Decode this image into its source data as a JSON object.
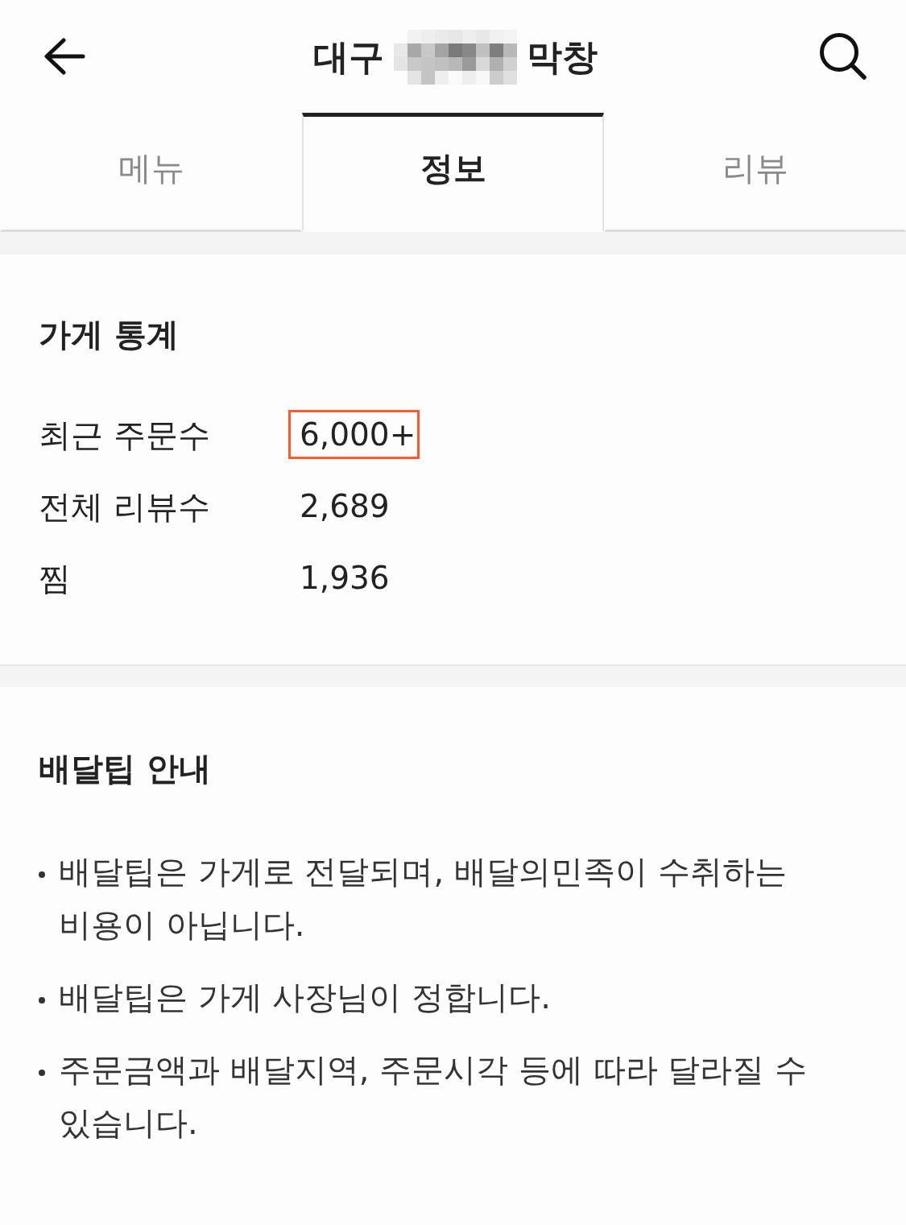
{
  "header": {
    "title": {
      "start": "대구",
      "end": "막창",
      "redacted": true
    }
  },
  "tabs": [
    {
      "label": "메뉴",
      "selected": false
    },
    {
      "label": "정보",
      "selected": true
    },
    {
      "label": "리뷰",
      "selected": false
    }
  ],
  "store_stats": {
    "heading": "가게 통계",
    "rows": [
      {
        "label": "최근 주문수",
        "value": "6,000+",
        "highlighted": true
      },
      {
        "label": "전체 리뷰수",
        "value": "2,689",
        "highlighted": false
      },
      {
        "label": "찜",
        "value": "1,936",
        "highlighted": false
      }
    ]
  },
  "delivery_tip_info": {
    "heading": "배달팁 안내",
    "items": [
      "배달팁은 가게로 전달되며, 배달의민족이 수취하는 비용이 아닙니다.",
      "배달팁은 가게 사장님이 정합니다.",
      "주문금액과 배달지역, 주문시각 등에 따라 달라질 수 있습니다."
    ]
  }
}
